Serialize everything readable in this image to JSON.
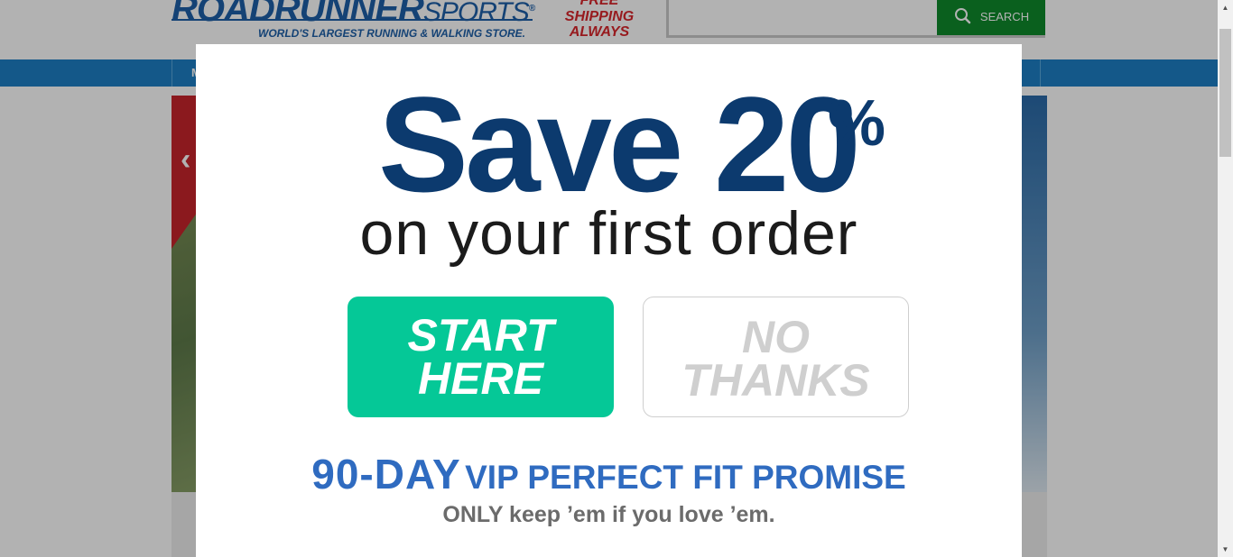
{
  "header": {
    "logo_bold": "ROADRUNNER",
    "logo_thin": "SPORTS",
    "logo_mark": "®",
    "tagline": "WORLD'S LARGEST RUNNING & WALKING STORE.",
    "free_shipping": [
      "FREE",
      "SHIPPING",
      "ALWAYS"
    ],
    "search": {
      "placeholder": "",
      "button_label": "SEARCH"
    }
  },
  "nav": {
    "first_initial": "M"
  },
  "modal": {
    "headline": "Save 20",
    "headline_percent": "%",
    "subheadline": "on your first order",
    "start_button": [
      "START",
      "HERE"
    ],
    "no_button": [
      "NO",
      "THANKS"
    ],
    "promise_big": "90-DAY",
    "promise_rest": "VIP PERFECT FIT PROMISE",
    "promise_sub": "ONLY keep ’em if you love ’em."
  },
  "colors": {
    "brand_blue": "#1d5fa8",
    "nav_blue": "#1e7fc4",
    "headline_navy": "#0c3a6e",
    "start_green": "#05c897",
    "search_green": "#0f8a2c",
    "promise_blue": "#2f6bc0",
    "free_ship_red": "#d8262c"
  }
}
